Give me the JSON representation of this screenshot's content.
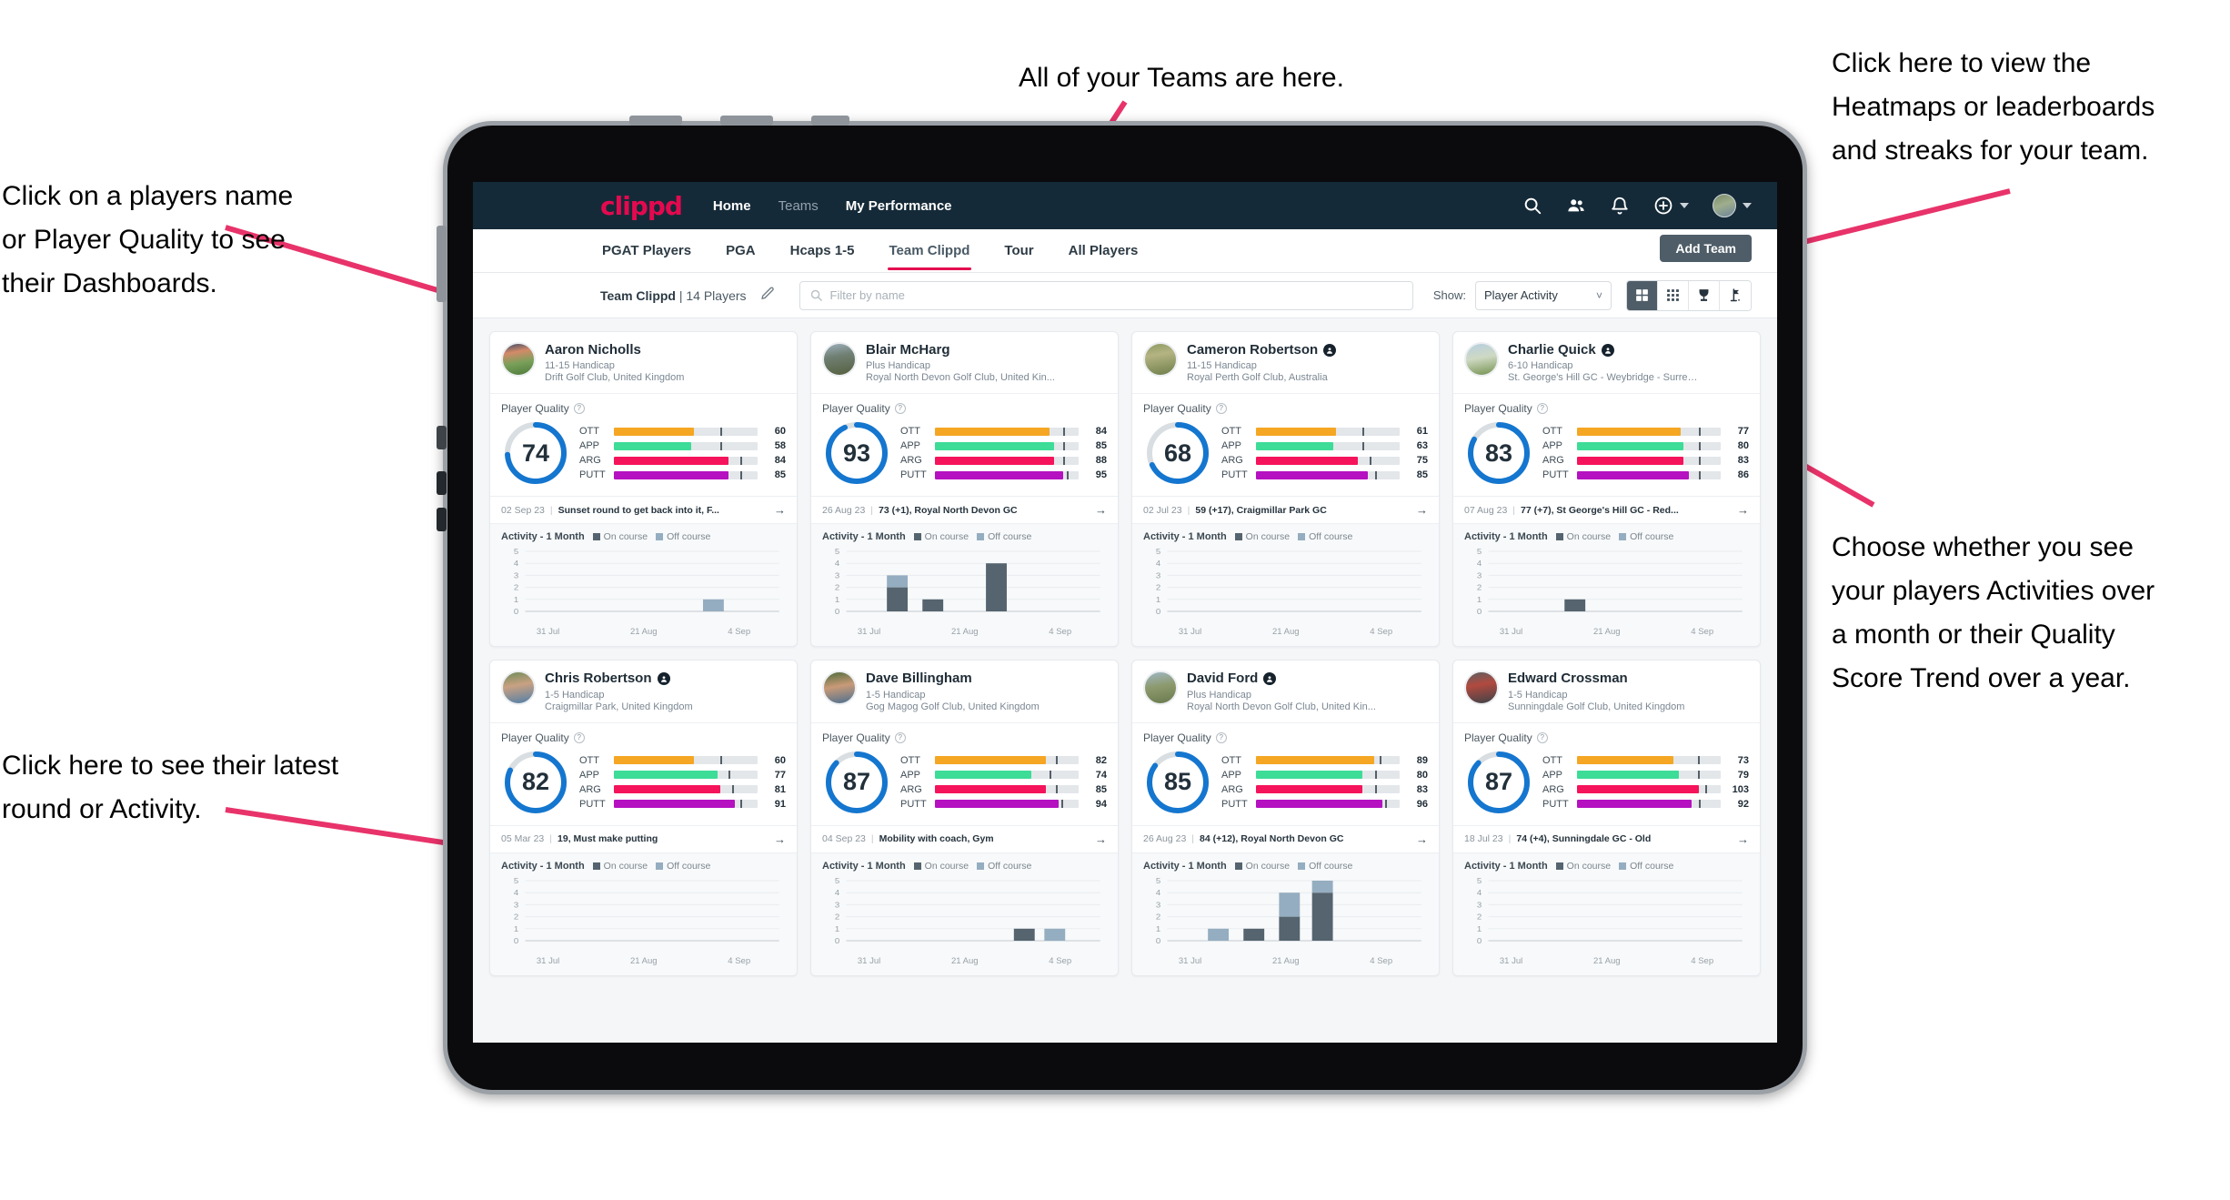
{
  "annotations": {
    "top_left": "Click on a players name\nor Player Quality to see\ntheir Dashboards.",
    "bottom_left": "Click here to see their latest\nround or Activity.",
    "top_center": "All of your Teams are here.",
    "top_right": "Click here to view the\nHeatmaps or leaderboards\nand streaks for your team.",
    "bottom_right": "Choose whether you see\nyour players Activities over\na month or their Quality\nScore Trend over a year.",
    "arrow_color": "#e8336a"
  },
  "navbar": {
    "logo": "clippd",
    "links": [
      {
        "label": "Home",
        "active": true
      },
      {
        "label": "Teams",
        "active": false
      },
      {
        "label": "My Performance",
        "active": true
      }
    ],
    "icons": [
      "search-icon",
      "people-icon",
      "bell-icon",
      "plus-circle-icon",
      "avatar"
    ]
  },
  "subtabs": {
    "tabs": [
      {
        "label": "PGAT Players",
        "active": false
      },
      {
        "label": "PGA",
        "active": false
      },
      {
        "label": "Hcaps 1-5",
        "active": false
      },
      {
        "label": "Team Clippd",
        "active": true
      },
      {
        "label": "Tour",
        "active": false
      },
      {
        "label": "All Players",
        "active": false
      }
    ],
    "add_team_label": "Add Team"
  },
  "toolbar": {
    "team_name": "Team Clippd",
    "player_count": "| 14 Players",
    "edit_icon": "pencil-icon",
    "search_placeholder": "Filter by name",
    "show_label": "Show:",
    "select_value": "Player Activity",
    "views": [
      {
        "name": "grid-large-view",
        "active": true
      },
      {
        "name": "grid-dense-view",
        "active": false
      },
      {
        "name": "trophy-leaderboard-view",
        "active": false
      },
      {
        "name": "golf-flag-heatmap-view",
        "active": false
      }
    ]
  },
  "card_labels": {
    "player_quality": "Player Quality",
    "activity_title": "Activity - 1 Month",
    "legend_on": "On course",
    "legend_off": "Off course",
    "metrics": [
      "OTT",
      "APP",
      "ARG",
      "PUTT"
    ],
    "y_ticks": [
      "5",
      "4",
      "3",
      "2",
      "1",
      "0"
    ],
    "x_ticks": [
      "31 Jul",
      "21 Aug",
      "4 Sep"
    ],
    "colors": {
      "ott": "#f5a623",
      "app": "#3ddc97",
      "arg": "#f5145b",
      "putt": "#b511c1",
      "ring": "#1476cf",
      "ring_track": "#d9dee2",
      "on_course": "#55646f",
      "off_course": "#95adc0"
    }
  },
  "players": [
    {
      "name": "Aaron Nicholls",
      "verified": false,
      "handicap": "11-15 Handicap",
      "club": "Drift Golf Club, United Kingdom",
      "quality": 74,
      "metrics": [
        {
          "key": "OTT",
          "value": 60,
          "fill_pct": 56,
          "tick_pct": 74
        },
        {
          "key": "APP",
          "value": 58,
          "fill_pct": 54,
          "tick_pct": 74
        },
        {
          "key": "ARG",
          "value": 84,
          "fill_pct": 80,
          "tick_pct": 88
        },
        {
          "key": "PUTT",
          "value": 85,
          "fill_pct": 80,
          "tick_pct": 88
        }
      ],
      "round_date": "02 Sep 23",
      "round_text": "Sunset round to get back into it, F...",
      "avatar_css": "linear-gradient(170deg,#3b4a66 0%,#d48a68 28%,#79a05a 60%,#4e7a3a 100%)",
      "activity": [
        {
          "x": 0.7,
          "on": 0,
          "off": 1
        }
      ]
    },
    {
      "name": "Blair McHarg",
      "verified": false,
      "handicap": "Plus Handicap",
      "club": "Royal North Devon Golf Club, United Kin...",
      "quality": 93,
      "metrics": [
        {
          "key": "OTT",
          "value": 84,
          "fill_pct": 80,
          "tick_pct": 89
        },
        {
          "key": "APP",
          "value": 85,
          "fill_pct": 83,
          "tick_pct": 89
        },
        {
          "key": "ARG",
          "value": 88,
          "fill_pct": 83,
          "tick_pct": 89
        },
        {
          "key": "PUTT",
          "value": 95,
          "fill_pct": 89,
          "tick_pct": 92
        }
      ],
      "round_date": "26 Aug 23",
      "round_text": "73 (+1), Royal North Devon GC",
      "avatar_css": "linear-gradient(170deg,#9fb0bd 0%,#6f7f72 40%,#56603f 100%)",
      "activity": [
        {
          "x": 0.16,
          "on": 2,
          "off": 1
        },
        {
          "x": 0.3,
          "on": 1,
          "off": 0
        },
        {
          "x": 0.55,
          "on": 4,
          "off": 0
        }
      ]
    },
    {
      "name": "Cameron Robertson",
      "verified": true,
      "handicap": "11-15 Handicap",
      "club": "Royal Perth Golf Club, Australia",
      "quality": 68,
      "metrics": [
        {
          "key": "OTT",
          "value": 61,
          "fill_pct": 56,
          "tick_pct": 74
        },
        {
          "key": "APP",
          "value": 63,
          "fill_pct": 54,
          "tick_pct": 74
        },
        {
          "key": "ARG",
          "value": 75,
          "fill_pct": 71,
          "tick_pct": 79
        },
        {
          "key": "PUTT",
          "value": 85,
          "fill_pct": 78,
          "tick_pct": 83
        }
      ],
      "round_date": "02 Jul 23",
      "round_text": "59 (+17), Craigmillar Park GC",
      "avatar_css": "linear-gradient(170deg,#8e9a63 0%,#b4b482 35%,#6e7e4a 100%)",
      "activity": []
    },
    {
      "name": "Charlie Quick",
      "verified": true,
      "handicap": "6-10 Handicap",
      "club": "St. George's Hill GC - Weybridge - Surrey, ...",
      "quality": 83,
      "metrics": [
        {
          "key": "OTT",
          "value": 77,
          "fill_pct": 72,
          "tick_pct": 85
        },
        {
          "key": "APP",
          "value": 80,
          "fill_pct": 74,
          "tick_pct": 85
        },
        {
          "key": "ARG",
          "value": 83,
          "fill_pct": 74,
          "tick_pct": 85
        },
        {
          "key": "PUTT",
          "value": 86,
          "fill_pct": 78,
          "tick_pct": 85
        }
      ],
      "round_date": "07 Aug 23",
      "round_text": "77 (+7), St George's Hill GC - Red...",
      "avatar_css": "linear-gradient(170deg,#b6cfe0 0%,#cfd9c3 45%,#74924f 100%)",
      "activity": [
        {
          "x": 0.3,
          "on": 1,
          "off": 0
        }
      ]
    },
    {
      "name": "Chris Robertson",
      "verified": true,
      "handicap": "1-5 Handicap",
      "club": "Craigmillar Park, United Kingdom",
      "quality": 82,
      "metrics": [
        {
          "key": "OTT",
          "value": 60,
          "fill_pct": 56,
          "tick_pct": 74
        },
        {
          "key": "APP",
          "value": 77,
          "fill_pct": 72,
          "tick_pct": 80
        },
        {
          "key": "ARG",
          "value": 81,
          "fill_pct": 74,
          "tick_pct": 82
        },
        {
          "key": "PUTT",
          "value": 91,
          "fill_pct": 84,
          "tick_pct": 88
        }
      ],
      "round_date": "05 Mar 23",
      "round_text": "19, Must make putting",
      "avatar_css": "linear-gradient(170deg,#6f8b5a 0%,#c9a182 42%,#4f7ea8 100%)",
      "activity": []
    },
    {
      "name": "Dave Billingham",
      "verified": false,
      "handicap": "1-5 Handicap",
      "club": "Gog Magog Golf Club, United Kingdom",
      "quality": 87,
      "metrics": [
        {
          "key": "OTT",
          "value": 82,
          "fill_pct": 77,
          "tick_pct": 84
        },
        {
          "key": "APP",
          "value": 74,
          "fill_pct": 67,
          "tick_pct": 80
        },
        {
          "key": "ARG",
          "value": 85,
          "fill_pct": 77,
          "tick_pct": 84
        },
        {
          "key": "PUTT",
          "value": 94,
          "fill_pct": 86,
          "tick_pct": 88
        }
      ],
      "round_date": "04 Sep 23",
      "round_text": "Mobility with coach, Gym",
      "avatar_css": "linear-gradient(170deg,#4d6b3c 0%,#c99a78 45%,#4a6f8f 100%)",
      "activity": [
        {
          "x": 0.66,
          "on": 1,
          "off": 0
        },
        {
          "x": 0.78,
          "on": 0,
          "off": 1
        }
      ]
    },
    {
      "name": "David Ford",
      "verified": true,
      "handicap": "Plus Handicap",
      "club": "Royal North Devon Golf Club, United Kin...",
      "quality": 85,
      "metrics": [
        {
          "key": "OTT",
          "value": 89,
          "fill_pct": 82,
          "tick_pct": 86
        },
        {
          "key": "APP",
          "value": 80,
          "fill_pct": 74,
          "tick_pct": 83
        },
        {
          "key": "ARG",
          "value": 83,
          "fill_pct": 74,
          "tick_pct": 83
        },
        {
          "key": "PUTT",
          "value": 96,
          "fill_pct": 88,
          "tick_pct": 90
        }
      ],
      "round_date": "26 Aug 23",
      "round_text": "84 (+12), Royal North Devon GC",
      "avatar_css": "linear-gradient(170deg,#9fb7c6 0%,#8d9a6d 45%,#6a7a4e 100%)",
      "activity": [
        {
          "x": 0.16,
          "on": 0,
          "off": 1
        },
        {
          "x": 0.3,
          "on": 1,
          "off": 0
        },
        {
          "x": 0.44,
          "on": 2,
          "off": 2
        },
        {
          "x": 0.57,
          "on": 4,
          "off": 1
        }
      ]
    },
    {
      "name": "Edward Crossman",
      "verified": false,
      "handicap": "1-5 Handicap",
      "club": "Sunningdale Golf Club, United Kingdom",
      "quality": 87,
      "metrics": [
        {
          "key": "OTT",
          "value": 73,
          "fill_pct": 67,
          "tick_pct": 84
        },
        {
          "key": "APP",
          "value": 79,
          "fill_pct": 71,
          "tick_pct": 84
        },
        {
          "key": "ARG",
          "value": 103,
          "fill_pct": 85,
          "tick_pct": 89
        },
        {
          "key": "PUTT",
          "value": 92,
          "fill_pct": 80,
          "tick_pct": 85
        }
      ],
      "round_date": "18 Jul 23",
      "round_text": "74 (+4), Sunningdale GC - Old",
      "avatar_css": "linear-gradient(170deg,#5b5f63 0%,#b24a3f 40%,#3d4348 100%)",
      "activity": []
    }
  ]
}
